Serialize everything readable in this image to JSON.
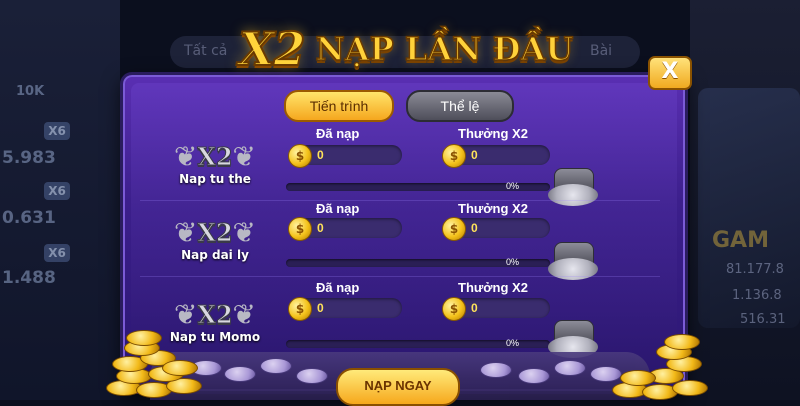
{
  "title": {
    "multiplier": "X2",
    "text": "NẠP LẦN ĐẦU"
  },
  "close_label": "X",
  "tabs": [
    {
      "label": "Tiến trình",
      "active": true
    },
    {
      "label": "Thể lệ",
      "active": false
    }
  ],
  "column_headers": {
    "deposited": "Đã nạp",
    "bonus": "Thưởng X2"
  },
  "rows": [
    {
      "badge": "X2",
      "label": "Nap tu the",
      "deposited": "0",
      "bonus": "0",
      "progress_percent": "0%"
    },
    {
      "badge": "X2",
      "label": "Nap dai ly",
      "deposited": "0",
      "bonus": "0",
      "progress_percent": "0%"
    },
    {
      "badge": "X2",
      "label": "Nap tu Momo",
      "deposited": "0",
      "bonus": "0",
      "progress_percent": "0%"
    }
  ],
  "cta_label": "NẠP NGAY",
  "background": {
    "left_stats": [
      "10K",
      "X6",
      "5.983",
      "X6",
      "0.631",
      "X6",
      "1.488"
    ],
    "topbar_left": "Tất cả",
    "topbar_right": "Bài",
    "right_title": "GAM",
    "right_numbers": [
      "81.177.8",
      "1.136.8",
      "516.31"
    ]
  },
  "colors": {
    "gold": "#ffd43b",
    "dialog_purple": "#4a27a0",
    "coin": "#f4c21a"
  }
}
